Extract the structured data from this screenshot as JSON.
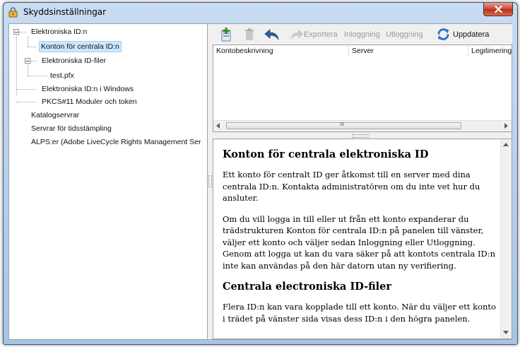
{
  "window": {
    "title": "Skyddsinställningar"
  },
  "tree": {
    "items": [
      {
        "label": "Elektroniska ID:n"
      },
      {
        "label": "Konton för centrala ID:n"
      },
      {
        "label": "Elektroniska ID-filer"
      },
      {
        "label": "test.pfx"
      },
      {
        "label": "Elektroniska ID:n i Windows"
      },
      {
        "label": "PKCS#11 Moduler och token"
      },
      {
        "label": "Katalogservrar"
      },
      {
        "label": "Servrar för tidsstämpling"
      },
      {
        "label": "ALPS:er (Adobe LiveCycle Rights Management Ser"
      }
    ]
  },
  "toolbar": {
    "export_label": "Exportera",
    "login_label": "Inloggning",
    "logout_label": "Utloggning",
    "update_label": "Uppdatera"
  },
  "list": {
    "columns": [
      "Kontobeskrivning",
      "Server",
      "Legitimeringsst"
    ],
    "scroll_grip": "III"
  },
  "help": {
    "heading1": "Konton för centrala elektroniska ID",
    "para1": "Ett konto för centralt ID ger åtkomst till en server med dina centrala ID:n. Kontakta administratören om du inte vet hur du ansluter.",
    "para2": "Om du vill logga in till eller ut från ett konto expanderar du trädstrukturen Konton för centrala ID:n på panelen till vänster, väljer ett konto och väljer sedan Inloggning eller Utloggning. Genom att logga ut kan du vara säker på att kontots centrala ID:n inte kan användas på den här datorn utan ny verifiering.",
    "heading2": "Centrala electroniska ID-filer",
    "para3": "Flera ID:n kan vara kopplade till ett konto. När du väljer ett konto i trädet på vänster sida visas dess ID:n i den högra panelen."
  },
  "colors": {
    "selection": "#cce8ff",
    "close_button": "#c9452f",
    "titlebar": "#b9d1ea"
  }
}
